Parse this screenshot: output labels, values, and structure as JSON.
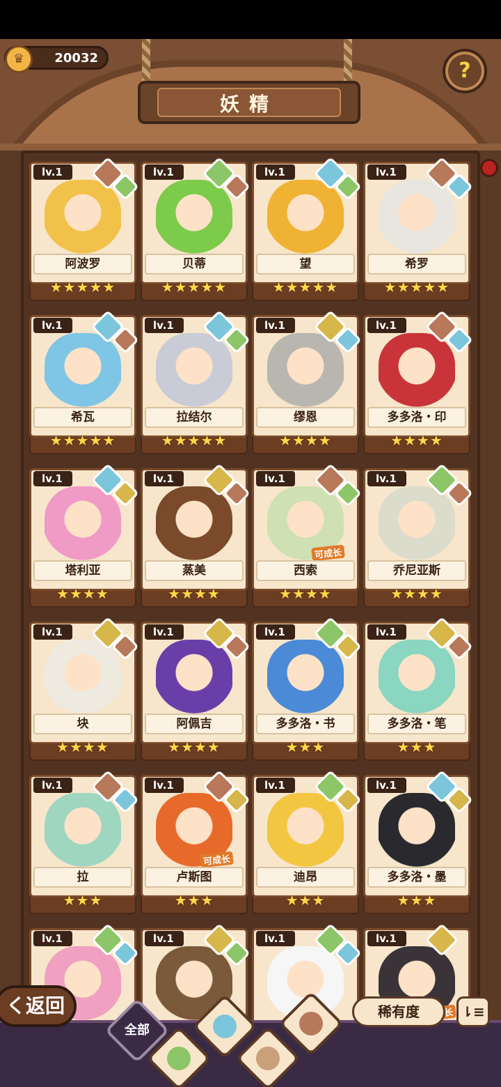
{
  "header": {
    "currency_value": "20032",
    "title": "妖精",
    "help_symbol": "?"
  },
  "cards": [
    {
      "level": "lv.1",
      "name": "阿波罗",
      "stars": "★★★★★",
      "elements": [
        "earth",
        "wind"
      ],
      "color": "#f2c14a",
      "growable": false
    },
    {
      "level": "lv.1",
      "name": "贝蒂",
      "stars": "★★★★★",
      "elements": [
        "wind",
        "earth"
      ],
      "color": "#7ccb4a",
      "growable": false
    },
    {
      "level": "lv.1",
      "name": "望",
      "stars": "★★★★★",
      "elements": [
        "water",
        "wind"
      ],
      "color": "#f0b233",
      "growable": false
    },
    {
      "level": "lv.1",
      "name": "希罗",
      "stars": "★★★★★",
      "elements": [
        "earth",
        "water"
      ],
      "color": "#e9e6e0",
      "growable": false
    },
    {
      "level": "lv.1",
      "name": "希瓦",
      "stars": "★★★★★",
      "elements": [
        "water",
        "earth"
      ],
      "color": "#7fc6e6",
      "growable": false
    },
    {
      "level": "lv.1",
      "name": "拉结尔",
      "stars": "★★★★★",
      "elements": [
        "water",
        "wind"
      ],
      "color": "#c9ccd6",
      "growable": false
    },
    {
      "level": "lv.1",
      "name": "缪恩",
      "stars": "★★★★",
      "elements": [
        "stone",
        "water"
      ],
      "color": "#b9b6b0",
      "growable": false
    },
    {
      "level": "lv.1",
      "name": "多多洛・印",
      "stars": "★★★★",
      "elements": [
        "earth",
        "water"
      ],
      "color": "#c8343a",
      "growable": false
    },
    {
      "level": "lv.1",
      "name": "塔利亚",
      "stars": "★★★★",
      "elements": [
        "water",
        "stone"
      ],
      "color": "#f09ac6",
      "growable": false
    },
    {
      "level": "lv.1",
      "name": "蒸美",
      "stars": "★★★★",
      "elements": [
        "stone",
        "earth"
      ],
      "color": "#7a4a2a",
      "growable": false
    },
    {
      "level": "lv.1",
      "name": "西索",
      "stars": "★★★★",
      "elements": [
        "earth",
        "wind"
      ],
      "color": "#cfe0b2",
      "growable": true
    },
    {
      "level": "lv.1",
      "name": "乔尼亚斯",
      "stars": "★★★★",
      "elements": [
        "wind",
        "earth"
      ],
      "color": "#dcdccc",
      "growable": false
    },
    {
      "level": "lv.1",
      "name": "块",
      "stars": "★★★★",
      "elements": [
        "stone",
        "earth"
      ],
      "color": "#eeeae0",
      "growable": false
    },
    {
      "level": "lv.1",
      "name": "阿佩吉",
      "stars": "★★★★",
      "elements": [
        "stone",
        "earth"
      ],
      "color": "#6a3ea8",
      "growable": false
    },
    {
      "level": "lv.1",
      "name": "多多洛・书",
      "stars": "★★★",
      "elements": [
        "wind",
        "stone"
      ],
      "color": "#4a8ad6",
      "growable": false
    },
    {
      "level": "lv.1",
      "name": "多多洛・笔",
      "stars": "★★★",
      "elements": [
        "stone",
        "earth"
      ],
      "color": "#8ad6c0",
      "growable": false
    },
    {
      "level": "lv.1",
      "name": "拉",
      "stars": "★★★",
      "elements": [
        "earth",
        "water"
      ],
      "color": "#9ed6c0",
      "growable": false
    },
    {
      "level": "lv.1",
      "name": "卢斯图",
      "stars": "★★★",
      "elements": [
        "earth",
        "stone"
      ],
      "color": "#e86a2a",
      "growable": true
    },
    {
      "level": "lv.1",
      "name": "迪昂",
      "stars": "★★★",
      "elements": [
        "wind",
        "stone"
      ],
      "color": "#f2c640",
      "growable": false
    },
    {
      "level": "lv.1",
      "name": "多多洛・墨",
      "stars": "★★★",
      "elements": [
        "water",
        "stone"
      ],
      "color": "#2a2a2e",
      "growable": false
    },
    {
      "level": "lv.1",
      "name": "",
      "stars": "",
      "elements": [
        "wind",
        "water"
      ],
      "color": "#f0a0c0",
      "growable": false
    },
    {
      "level": "lv.1",
      "name": "",
      "stars": "",
      "elements": [
        "stone",
        "wind"
      ],
      "color": "#7a5a3a",
      "growable": false
    },
    {
      "level": "lv.1",
      "name": "",
      "stars": "",
      "elements": [
        "wind",
        "water"
      ],
      "color": "#f6f6f6",
      "growable": false
    },
    {
      "level": "lv.1",
      "name": "",
      "stars": "",
      "elements": [
        "stone"
      ],
      "color": "#3a3438",
      "growable": true
    }
  ],
  "grow_label": "可成长",
  "bottom": {
    "back_label": "く返回",
    "filter_all_label": "全部",
    "sort_label": "稀有度",
    "order_symbol": "⇂≡"
  }
}
